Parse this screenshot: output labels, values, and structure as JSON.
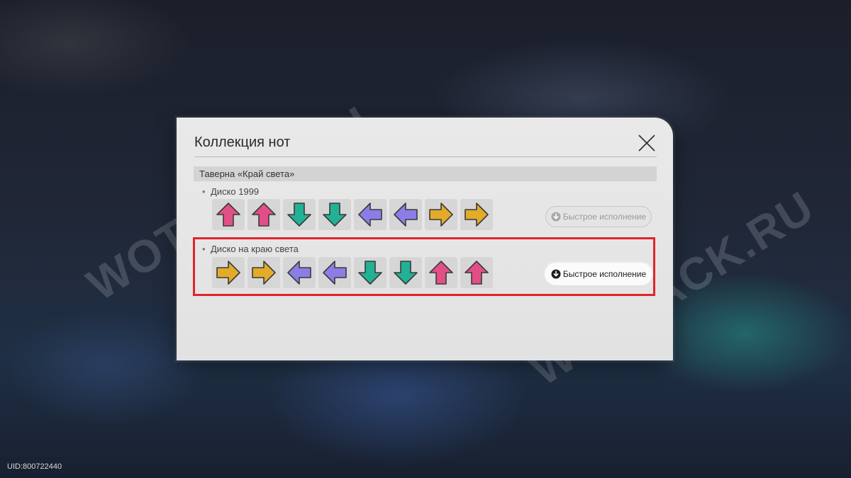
{
  "watermark_text": "WOTPACK.RU",
  "panel": {
    "title": "Коллекция нот",
    "section": "Таверна «Край света»",
    "songs": [
      {
        "name": "Диско 1999",
        "notes": [
          "up",
          "up",
          "down",
          "down",
          "left",
          "left",
          "right",
          "right"
        ],
        "quick_play": {
          "label": "Быстрое исполнение",
          "state": "disabled"
        }
      },
      {
        "name": "Диско на краю света",
        "notes": [
          "right",
          "right",
          "left",
          "left",
          "down",
          "down",
          "up",
          "up"
        ],
        "quick_play": {
          "label": "Быстрое исполнение",
          "state": "enabled"
        }
      }
    ]
  },
  "note_colors": {
    "up": "#e24f87",
    "down": "#22b195",
    "left": "#8a7ee6",
    "right": "#e2ab2a"
  },
  "uid": "UID:800722440",
  "icons": {
    "close": "close-icon",
    "quick_play": "arrow-down-circle-icon"
  },
  "highlight_color": "#e0232f"
}
